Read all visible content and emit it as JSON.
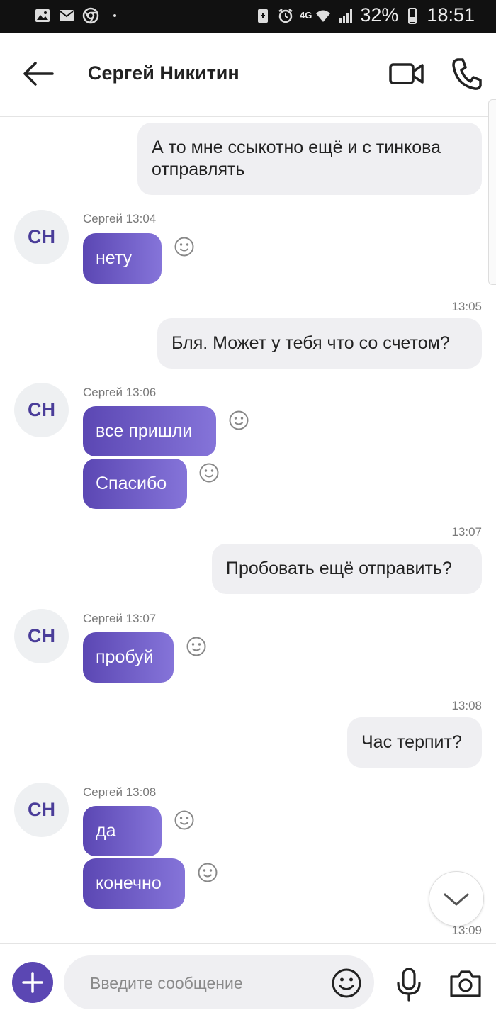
{
  "status_bar": {
    "icons_left": [
      "image-icon",
      "mail-icon",
      "chrome-icon",
      "dot-icon"
    ],
    "network": "4G",
    "battery": "32%",
    "time": "18:51"
  },
  "header": {
    "title": "Сергей Никитин",
    "back_icon": "arrow-left-icon",
    "video_icon": "video-camera-icon",
    "call_icon": "phone-icon"
  },
  "contact": {
    "initials": "СН"
  },
  "messages": [
    {
      "dir": "out",
      "text": "А то мне ссыкотно ещё и с тинкова отправлять"
    },
    {
      "dir": "in",
      "sender": "Сергей 13:04",
      "text": "нету"
    },
    {
      "dir": "out",
      "time": "13:05",
      "text": "Бля. Может у тебя что со счетом?"
    },
    {
      "dir": "in",
      "sender": "Сергей 13:06",
      "text": "все пришли"
    },
    {
      "dir": "in",
      "text": "Спасибо"
    },
    {
      "dir": "out",
      "time": "13:07",
      "text": "Пробовать ещё отправить?"
    },
    {
      "dir": "in",
      "sender": "Сергей 13:07",
      "text": "пробуй"
    },
    {
      "dir": "out",
      "time": "13:08",
      "text": "Час терпит?"
    },
    {
      "dir": "in",
      "sender": "Сергей 13:08",
      "text": "да"
    },
    {
      "dir": "in",
      "text": "конечно"
    },
    {
      "dir": "time",
      "time": "13:09"
    }
  ],
  "composer": {
    "placeholder": "Введите сообщение",
    "value": ""
  },
  "colors": {
    "accent": "#5b47b3",
    "incoming_bubble_start": "#5b47b3",
    "incoming_bubble_end": "#8574d9",
    "outgoing_bubble": "#efeff2"
  }
}
